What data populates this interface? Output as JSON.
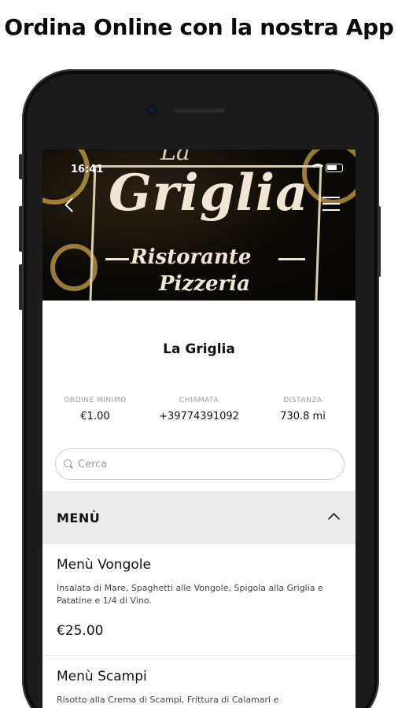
{
  "page": {
    "headline": "Ordina Online con la nostra App"
  },
  "status_bar": {
    "time": "16:41"
  },
  "hero": {
    "logo_top": "La",
    "logo_main": "Griglia",
    "logo_sub1": "Ristorante",
    "logo_sub2": "Pizzeria"
  },
  "restaurant": {
    "name": "La Griglia",
    "stats": [
      {
        "label": "ORDINE MINIMO",
        "value": "€1.00"
      },
      {
        "label": "CHIAMATA",
        "value": "+39774391092"
      },
      {
        "label": "DISTANZA",
        "value": "730.8 mi"
      }
    ]
  },
  "search": {
    "placeholder": "Cerca"
  },
  "menu": {
    "title": "MENÙ",
    "items": [
      {
        "name": "Menù Vongole",
        "description": "Insalata di Mare, Spaghetti alle Vongole, Spigola alla Griglia e Patatine e 1/4 di Vino.",
        "price": "€25.00"
      },
      {
        "name": "Menù Scampi",
        "description": "Risotto alla Crema di Scampi, Frittura di Calamari e"
      }
    ]
  }
}
